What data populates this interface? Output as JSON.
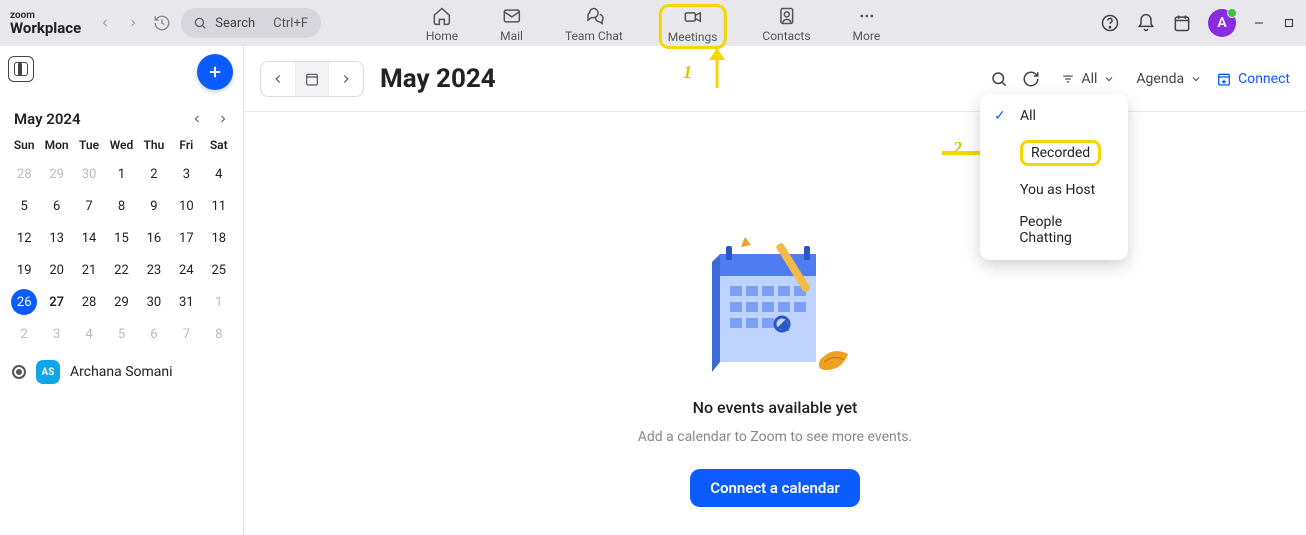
{
  "brand": {
    "zoom": "zoom",
    "work": "Workplace"
  },
  "search": {
    "label": "Search",
    "shortcut": "Ctrl+F"
  },
  "tabs": {
    "home": "Home",
    "mail": "Mail",
    "teamchat": "Team Chat",
    "meetings": "Meetings",
    "contacts": "Contacts",
    "more": "More"
  },
  "avatar": {
    "initial": "A"
  },
  "toolbar": {
    "title": "May 2024",
    "filter_label": "All",
    "agenda_label": "Agenda",
    "connect_label": "Connect"
  },
  "dropdown": {
    "all": "All",
    "recorded": "Recorded",
    "host": "You as Host",
    "chatting": "People Chatting"
  },
  "mini_calendar": {
    "label": "May  2024",
    "dow": [
      "Sun",
      "Mon",
      "Tue",
      "Wed",
      "Thu",
      "Fri",
      "Sat"
    ],
    "weeks": [
      [
        {
          "d": "28",
          "out": true
        },
        {
          "d": "29",
          "out": true
        },
        {
          "d": "30",
          "out": true
        },
        {
          "d": "1"
        },
        {
          "d": "2"
        },
        {
          "d": "3"
        },
        {
          "d": "4"
        }
      ],
      [
        {
          "d": "5"
        },
        {
          "d": "6"
        },
        {
          "d": "7"
        },
        {
          "d": "8"
        },
        {
          "d": "9"
        },
        {
          "d": "10"
        },
        {
          "d": "11"
        }
      ],
      [
        {
          "d": "12"
        },
        {
          "d": "13"
        },
        {
          "d": "14"
        },
        {
          "d": "15"
        },
        {
          "d": "16"
        },
        {
          "d": "17"
        },
        {
          "d": "18"
        }
      ],
      [
        {
          "d": "19"
        },
        {
          "d": "20"
        },
        {
          "d": "21"
        },
        {
          "d": "22"
        },
        {
          "d": "23"
        },
        {
          "d": "24"
        },
        {
          "d": "25"
        }
      ],
      [
        {
          "d": "26",
          "today": true
        },
        {
          "d": "27",
          "bold": true
        },
        {
          "d": "28"
        },
        {
          "d": "29"
        },
        {
          "d": "30"
        },
        {
          "d": "31"
        },
        {
          "d": "1",
          "out": true
        }
      ],
      [
        {
          "d": "2",
          "out": true
        },
        {
          "d": "3",
          "out": true
        },
        {
          "d": "4",
          "out": true
        },
        {
          "d": "5",
          "out": true
        },
        {
          "d": "6",
          "out": true
        },
        {
          "d": "7",
          "out": true
        },
        {
          "d": "8",
          "out": true
        }
      ]
    ]
  },
  "user": {
    "badge": "AS",
    "name": "Archana Somani"
  },
  "empty": {
    "title": "No events available yet",
    "subtitle": "Add a calendar to Zoom to see more events.",
    "button": "Connect a calendar"
  },
  "annotations": {
    "one": "1",
    "two": "2"
  }
}
